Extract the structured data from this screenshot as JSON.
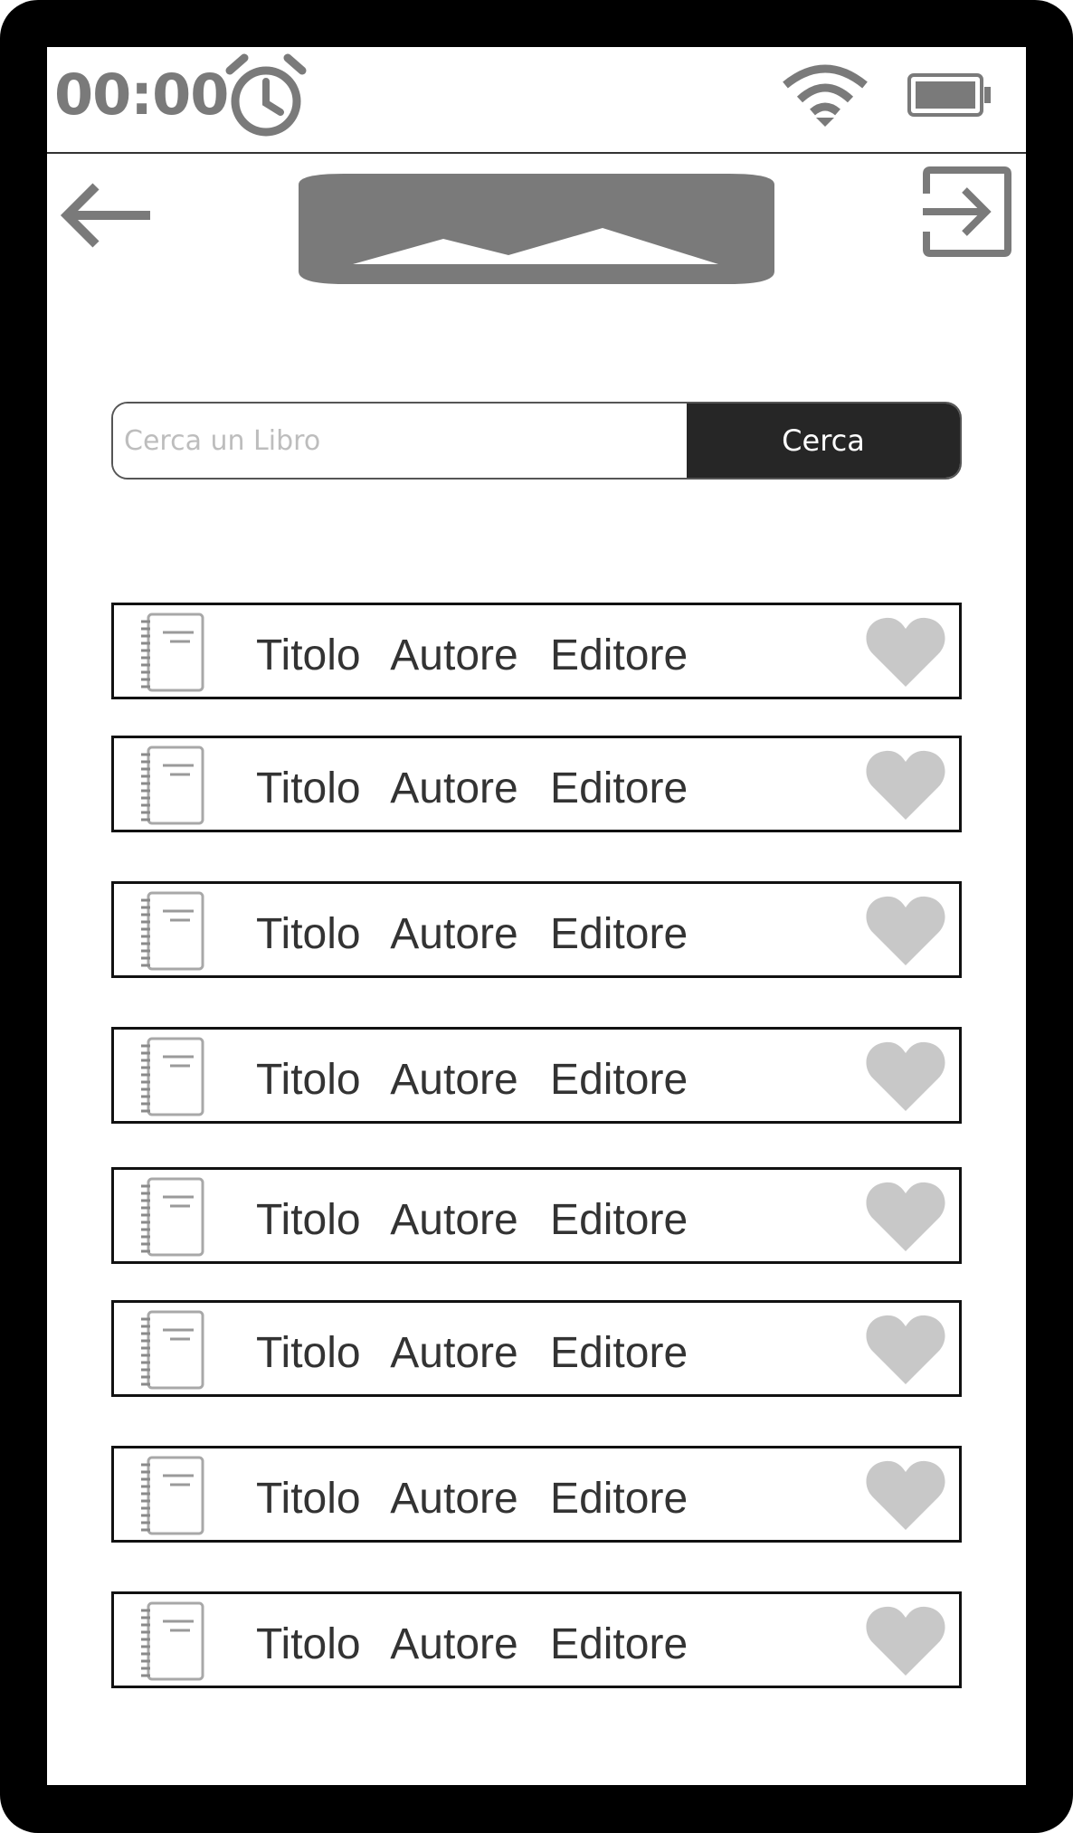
{
  "status_bar": {
    "time": "00:00",
    "alarm_icon": "alarm-clock-icon",
    "wifi_icon": "wifi-icon",
    "battery_icon": "battery-icon"
  },
  "header": {
    "back_icon": "arrow-left-icon",
    "logo_icon": "image-placeholder-icon",
    "logout_icon": "logout-icon"
  },
  "search": {
    "placeholder": "Cerca un Libro",
    "value": "",
    "button_label": "Cerca"
  },
  "books": [
    {
      "titolo": "Titolo",
      "autore": "Autore",
      "editore": "Editore"
    },
    {
      "titolo": "Titolo",
      "autore": "Autore",
      "editore": "Editore"
    },
    {
      "titolo": "Titolo",
      "autore": "Autore",
      "editore": "Editore"
    },
    {
      "titolo": "Titolo",
      "autore": "Autore",
      "editore": "Editore"
    },
    {
      "titolo": "Titolo",
      "autore": "Autore",
      "editore": "Editore"
    },
    {
      "titolo": "Titolo",
      "autore": "Autore",
      "editore": "Editore"
    },
    {
      "titolo": "Titolo",
      "autore": "Autore",
      "editore": "Editore"
    },
    {
      "titolo": "Titolo",
      "autore": "Autore",
      "editore": "Editore"
    }
  ],
  "colors": {
    "frame": "#000000",
    "icon_gray": "#7a7a7a",
    "heart": "#c8c8c8",
    "search_button": "#262626"
  }
}
